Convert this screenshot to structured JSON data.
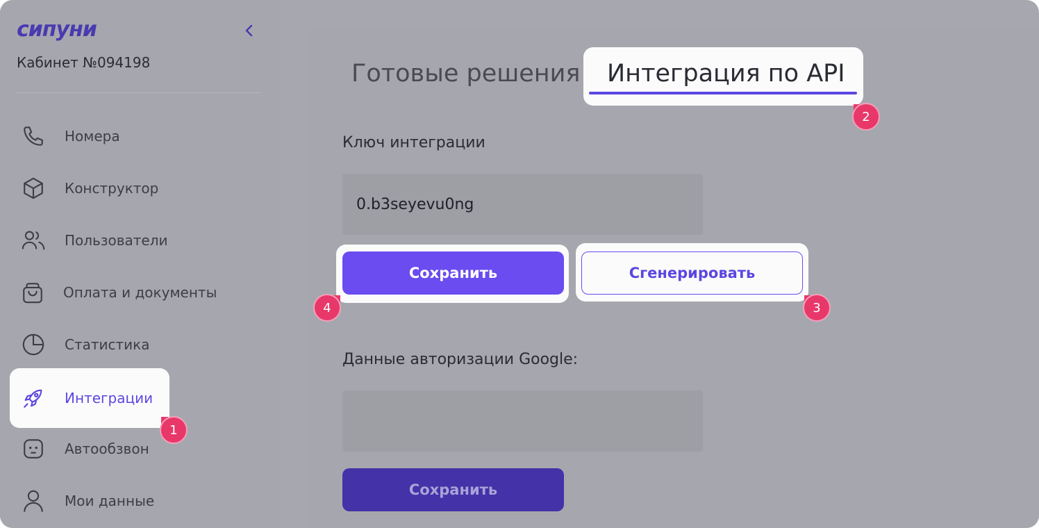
{
  "sidebar": {
    "logo_text": "сипуни",
    "collapse_glyph": "‹",
    "cabinet": "Кабинет №094198",
    "items": [
      {
        "label": "Номера",
        "icon": "phone-icon"
      },
      {
        "label": "Конструктор",
        "icon": "cube-icon"
      },
      {
        "label": "Пользователи",
        "icon": "users-icon"
      },
      {
        "label": "Оплата и документы",
        "icon": "shopping-bag-icon"
      },
      {
        "label": "Статистика",
        "icon": "pie-chart-icon"
      },
      {
        "label": "Интеграции",
        "icon": "rocket-icon",
        "active": true
      },
      {
        "label": "Автообзвон",
        "icon": "robot-icon"
      },
      {
        "label": "Мои данные",
        "icon": "user-icon"
      }
    ]
  },
  "tabs": {
    "ready": "Готовые решения",
    "api": "Интеграция по API"
  },
  "integration_key": {
    "label": "Ключ интеграции",
    "value": "0.b3seyevu0ng",
    "save_label": "Сохранить",
    "generate_label": "Сгенерировать"
  },
  "google_auth": {
    "label": "Данные авторизации Google:",
    "value": "",
    "save_label": "Сохранить"
  },
  "markers": [
    "1",
    "2",
    "3",
    "4"
  ],
  "colors": {
    "accent": "#6a4cf0",
    "marker": "#e8386a",
    "overlay": "#a7a8af"
  }
}
